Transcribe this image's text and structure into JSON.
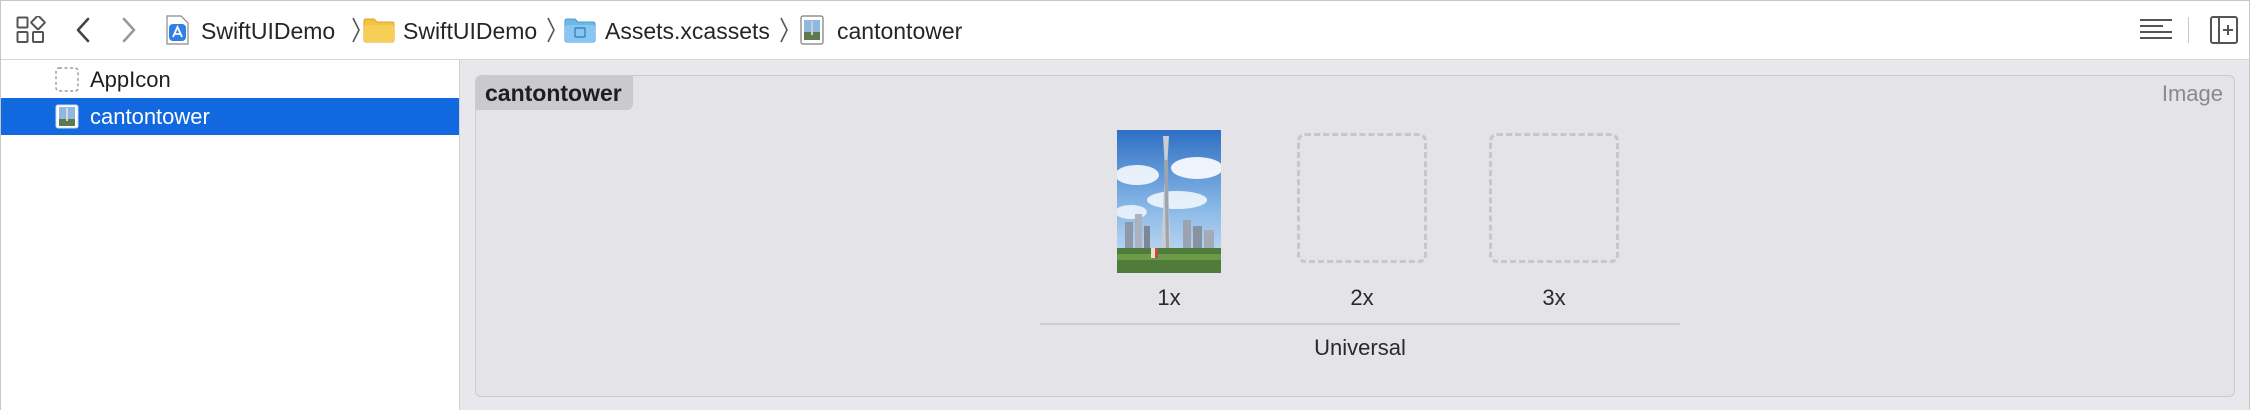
{
  "toolbar": {
    "grid_icon": "grid-icon",
    "back_icon": "chevron-left-icon",
    "forward_icon": "chevron-right-icon",
    "editor_options_icon": "lines-icon",
    "add_editor_icon": "add-editor-icon"
  },
  "breadcrumb": {
    "items": [
      {
        "label": "SwiftUIDemo",
        "icon": "app-project-icon"
      },
      {
        "label": "SwiftUIDemo",
        "icon": "folder-icon"
      },
      {
        "label": "Assets.xcassets",
        "icon": "asset-catalog-icon"
      },
      {
        "label": "cantontower",
        "icon": "image-file-icon"
      }
    ]
  },
  "sidebar": {
    "items": [
      {
        "label": "AppIcon",
        "icon": "app-icon-placeholder-icon",
        "selected": false
      },
      {
        "label": "cantontower",
        "icon": "image-set-icon",
        "selected": true
      }
    ]
  },
  "editor": {
    "asset_name": "cantontower",
    "asset_type": "Image",
    "slots": [
      {
        "label": "1x",
        "filled": true
      },
      {
        "label": "2x",
        "filled": false
      },
      {
        "label": "3x",
        "filled": false
      }
    ],
    "group_label": "Universal"
  },
  "colors": {
    "selection": "#1168df",
    "folder": "#f5c242",
    "asset_catalog": "#6cb6e8"
  }
}
